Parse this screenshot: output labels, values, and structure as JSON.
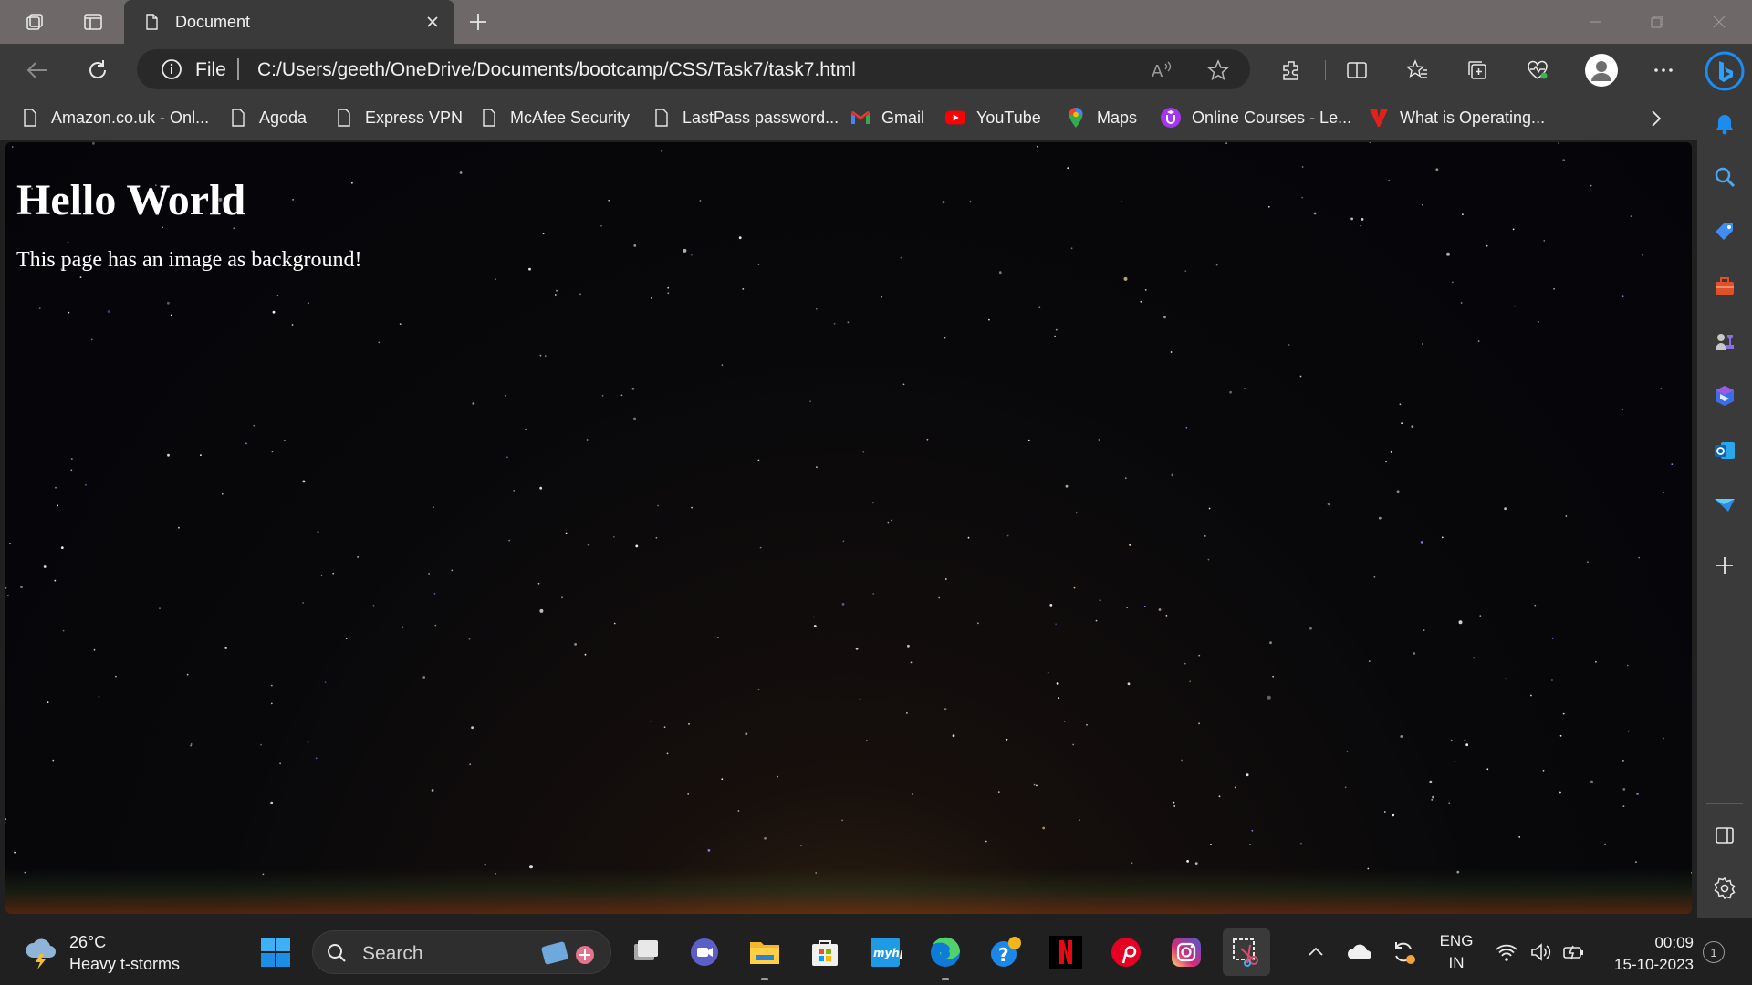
{
  "browser": {
    "tab_title": "Document",
    "address": {
      "scheme_label": "File",
      "url": "C:/Users/geeth/OneDrive/Documents/bootcamp/CSS/Task7/task7.html"
    },
    "favorites": [
      {
        "label": "Amazon.co.uk - Onl...",
        "icon": "page-icon"
      },
      {
        "label": "Agoda",
        "icon": "page-icon"
      },
      {
        "label": "Express VPN",
        "icon": "page-icon"
      },
      {
        "label": "McAfee Security",
        "icon": "page-icon"
      },
      {
        "label": "LastPass password...",
        "icon": "page-icon"
      },
      {
        "label": "Gmail",
        "icon": "gmail-icon"
      },
      {
        "label": "YouTube",
        "icon": "youtube-icon"
      },
      {
        "label": "Maps",
        "icon": "maps-icon"
      },
      {
        "label": "Online Courses - Le...",
        "icon": "udemy-icon"
      },
      {
        "label": "What is Operating...",
        "icon": "v-logo-icon"
      }
    ]
  },
  "page": {
    "heading": "Hello World",
    "paragraph": "This page has an image as background!"
  },
  "taskbar": {
    "weather": {
      "temp": "26°C",
      "desc": "Heavy t-storms"
    },
    "search_placeholder": "Search",
    "tray": {
      "lang_top": "ENG",
      "lang_bottom": "IN"
    },
    "clock": {
      "time": "00:09",
      "date": "15-10-2023"
    },
    "notification_count": "1"
  },
  "colors": {
    "titlebar": "#6e6868",
    "chrome": "#3a3a3a",
    "taskbar": "#202020",
    "edge_accent": "#1b8df0"
  }
}
